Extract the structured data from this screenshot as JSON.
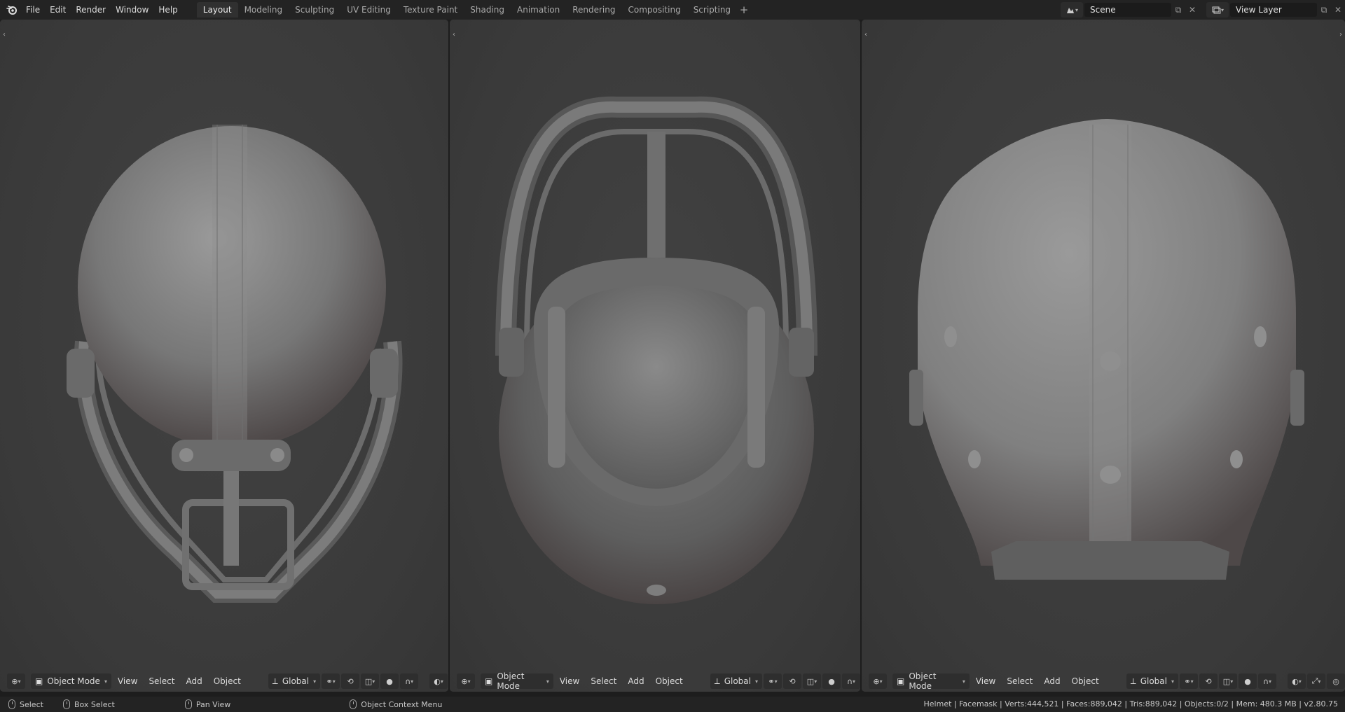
{
  "topbar": {
    "menus": [
      "File",
      "Edit",
      "Render",
      "Window",
      "Help"
    ],
    "workspaces": [
      "Layout",
      "Modeling",
      "Sculpting",
      "UV Editing",
      "Texture Paint",
      "Shading",
      "Animation",
      "Rendering",
      "Compositing",
      "Scripting"
    ],
    "active_workspace": "Layout",
    "scene_name": "Scene",
    "view_layer_name": "View Layer"
  },
  "viewports": [
    {
      "name": "bottom-view",
      "mode": "Object Mode",
      "menus": [
        "View",
        "Select",
        "Add",
        "Object"
      ],
      "transform": "Global"
    },
    {
      "name": "front-view",
      "mode": "Object Mode",
      "menus": [
        "View",
        "Select",
        "Add",
        "Object"
      ],
      "transform": "Global"
    },
    {
      "name": "back-view",
      "mode": "Object Mode",
      "menus": [
        "View",
        "Select",
        "Add",
        "Object"
      ],
      "transform": "Global"
    }
  ],
  "statusbar": {
    "select": "Select",
    "box_select": "Box Select",
    "pan_view": "Pan View",
    "context_menu": "Object Context Menu",
    "stats": "Helmet | Facemask | Verts:444,521 | Faces:889,042 | Tris:889,042 | Objects:0/2 | Mem: 480.3 MB | v2.80.75"
  },
  "colors": {
    "accent": "#4772b3",
    "viewport_bg": "#3d3d3d",
    "header_bg": "#232323",
    "model_gray": "#8a8a8a"
  }
}
